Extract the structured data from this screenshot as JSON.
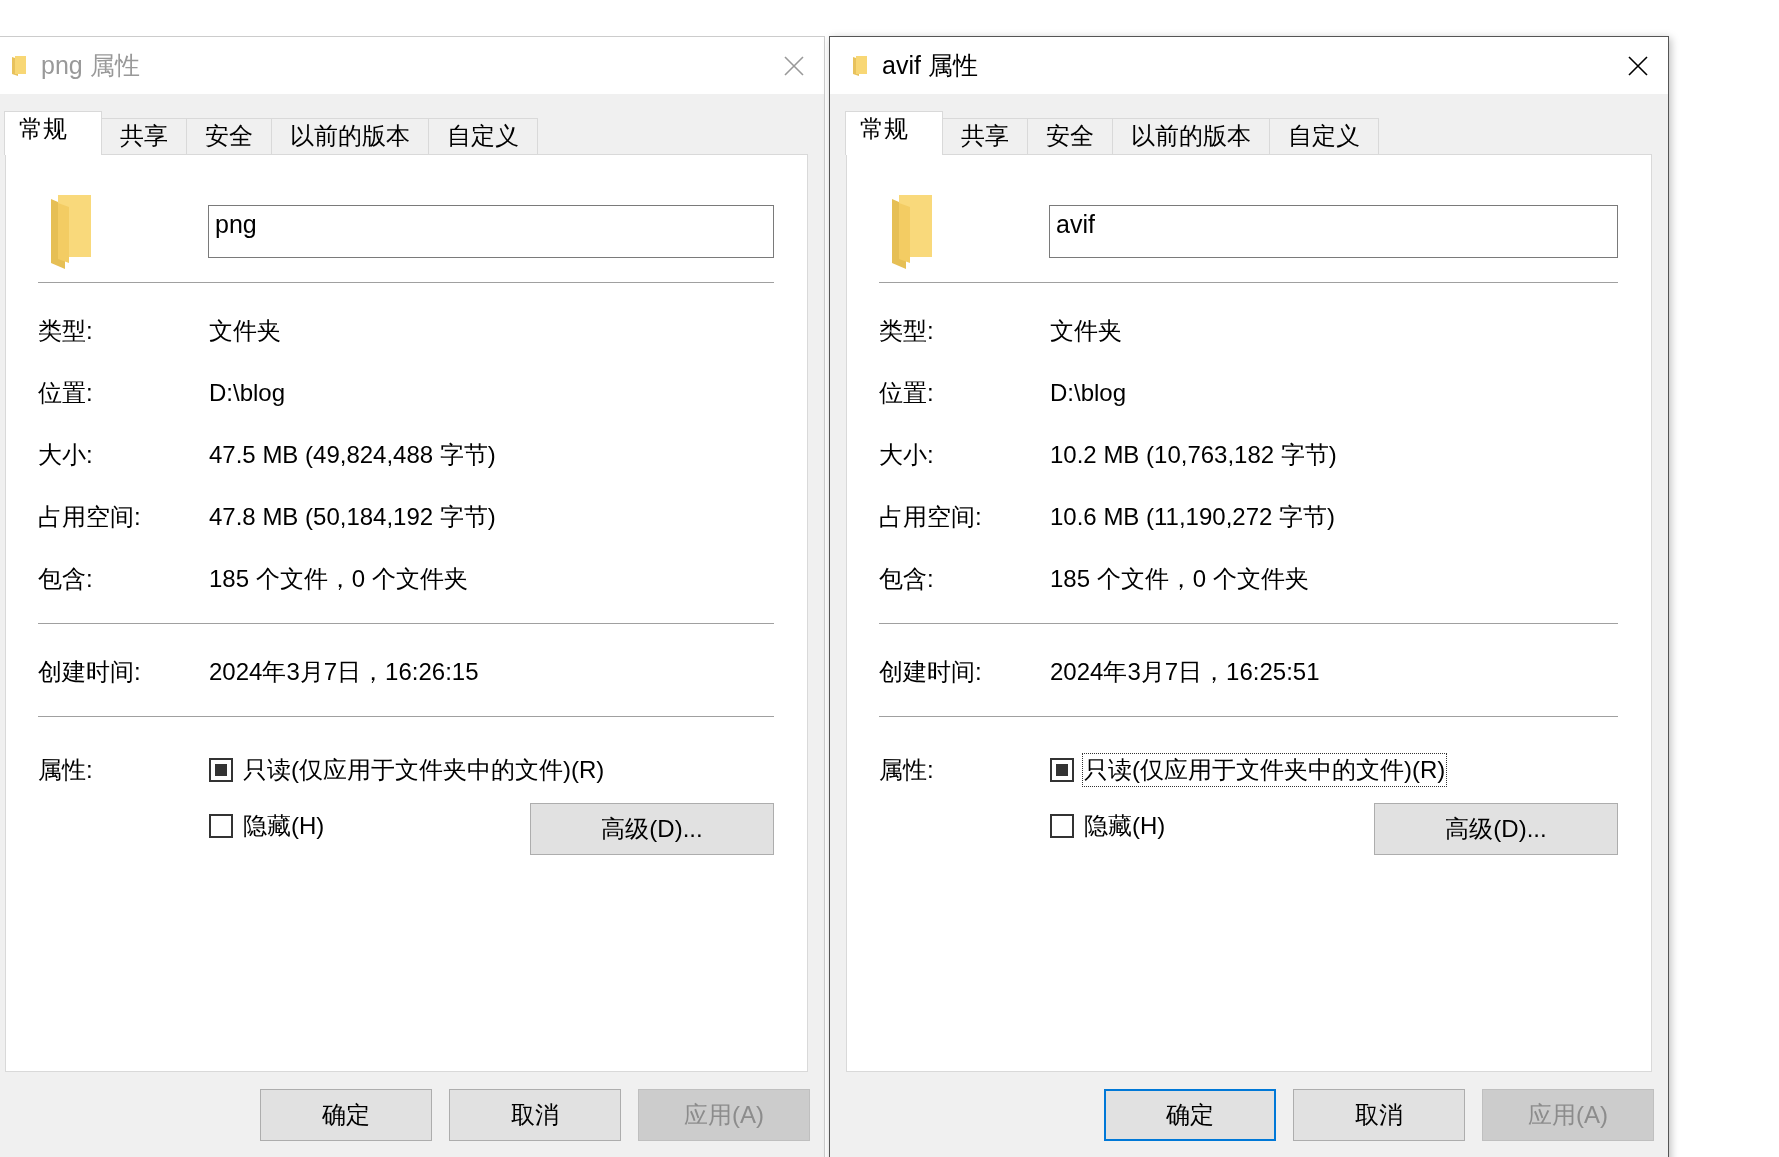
{
  "dialogs": [
    {
      "active": false,
      "title": "png 属性",
      "tabs": [
        {
          "label": "常规",
          "selected": true
        },
        {
          "label": "共享",
          "selected": false
        },
        {
          "label": "安全",
          "selected": false
        },
        {
          "label": "以前的版本",
          "selected": false
        },
        {
          "label": "自定义",
          "selected": false
        }
      ],
      "name_field": {
        "value": "png"
      },
      "sections": [
        [
          {
            "label": "类型:",
            "value": "文件夹"
          },
          {
            "label": "位置:",
            "value": "D:\\blog"
          },
          {
            "label": "大小:",
            "value": "47.5 MB (49,824,488 字节)"
          },
          {
            "label": "占用空间:",
            "value": "47.8 MB (50,184,192 字节)"
          },
          {
            "label": "包含:",
            "value": "185 个文件，0 个文件夹"
          }
        ],
        [
          {
            "label": "创建时间:",
            "value": "2024年3月7日，16:26:15"
          }
        ]
      ],
      "attributes": {
        "label": "属性:",
        "checkboxes": [
          {
            "label": "只读(仅应用于文件夹中的文件)(R)",
            "checked": false,
            "indeterminate": true,
            "focused": false
          },
          {
            "label": "隐藏(H)",
            "checked": false,
            "indeterminate": false,
            "focused": false
          }
        ],
        "advanced_button": "高级(D)..."
      },
      "buttons": [
        {
          "label": "确定",
          "disabled": false
        },
        {
          "label": "取消",
          "disabled": false
        },
        {
          "label": "应用(A)",
          "disabled": true
        }
      ]
    },
    {
      "active": true,
      "title": "avif 属性",
      "tabs": [
        {
          "label": "常规",
          "selected": true
        },
        {
          "label": "共享",
          "selected": false
        },
        {
          "label": "安全",
          "selected": false
        },
        {
          "label": "以前的版本",
          "selected": false
        },
        {
          "label": "自定义",
          "selected": false
        }
      ],
      "name_field": {
        "value": "avif"
      },
      "sections": [
        [
          {
            "label": "类型:",
            "value": "文件夹"
          },
          {
            "label": "位置:",
            "value": "D:\\blog"
          },
          {
            "label": "大小:",
            "value": "10.2 MB (10,763,182 字节)"
          },
          {
            "label": "占用空间:",
            "value": "10.6 MB (11,190,272 字节)"
          },
          {
            "label": "包含:",
            "value": "185 个文件，0 个文件夹"
          }
        ],
        [
          {
            "label": "创建时间:",
            "value": "2024年3月7日，16:25:51"
          }
        ]
      ],
      "attributes": {
        "label": "属性:",
        "checkboxes": [
          {
            "label": "只读(仅应用于文件夹中的文件)(R)",
            "checked": false,
            "indeterminate": true,
            "focused": true
          },
          {
            "label": "隐藏(H)",
            "checked": false,
            "indeterminate": false,
            "focused": false
          }
        ],
        "advanced_button": "高级(D)..."
      },
      "buttons": [
        {
          "label": "确定",
          "default": true,
          "disabled": false
        },
        {
          "label": "取消",
          "default": false,
          "disabled": false
        },
        {
          "label": "应用(A)",
          "default": false,
          "disabled": true
        }
      ]
    }
  ]
}
